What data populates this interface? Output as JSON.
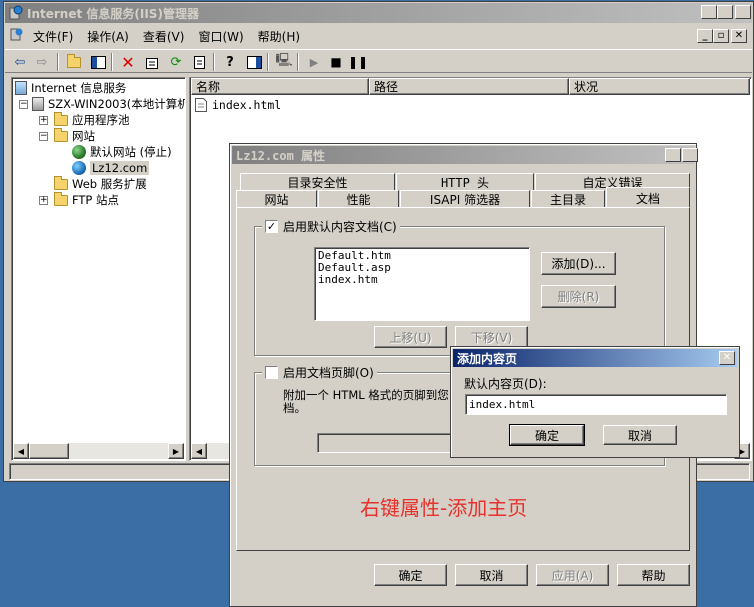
{
  "main_window": {
    "title": "Internet 信息服务(IIS)管理器",
    "menu": [
      "文件(F)",
      "操作(A)",
      "查看(V)",
      "窗口(W)",
      "帮助(H)"
    ]
  },
  "tree": {
    "root": "Internet 信息服务",
    "server": "SZX-WIN2003(本地计算机)",
    "app_pools": "应用程序池",
    "websites": "网站",
    "default_site": "默认网站 (停止)",
    "lz12": "Lz12.com",
    "web_ext": "Web 服务扩展",
    "ftp": "FTP 站点"
  },
  "list": {
    "columns": [
      "名称",
      "路径",
      "状况"
    ],
    "rows": [
      {
        "name": "index.html"
      }
    ]
  },
  "props_dialog": {
    "title": "Lz12.com 属性",
    "tabs_row1": [
      "目录安全性",
      "HTTP 头",
      "自定义错误"
    ],
    "tabs_row2": [
      "网站",
      "性能",
      "ISAPI 筛选器",
      "主目录",
      "文档"
    ],
    "enable_default_doc": "启用默认内容文档(C)",
    "default_docs": [
      "Default.htm",
      "Default.asp",
      "index.htm"
    ],
    "add_button": "添加(D)...",
    "remove_button": "删除(R)",
    "move_up": "上移(U)",
    "move_down": "下移(V)",
    "enable_footer": "启用文档页脚(O)",
    "footer_desc_1": "附加一个 HTML 格式的页脚到您",
    "footer_desc_2": "档。",
    "ok": "确定",
    "cancel": "取消",
    "apply": "应用(A)",
    "help": "帮助"
  },
  "add_dialog": {
    "title": "添加内容页",
    "label": "默认内容页(D):",
    "value": "index.html",
    "ok": "确定",
    "cancel": "取消"
  },
  "annotation": "右键属性-添加主页",
  "colors": {
    "desktop": "#3a6ea5",
    "face": "#d4d0c8",
    "active_title": "#0a246a",
    "inactive_title": "#808080",
    "annotation": "#e8312a"
  }
}
